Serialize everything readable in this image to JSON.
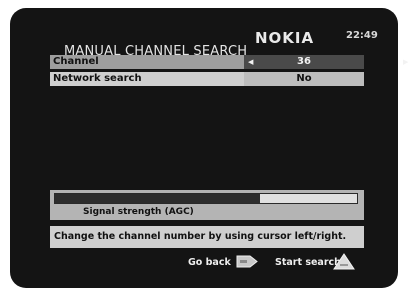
{
  "header": {
    "title": "MANUAL CHANNEL SEARCH",
    "brand": "NOKIA",
    "time": "22:49"
  },
  "menu": {
    "channel": {
      "label": "Channel",
      "value": "36"
    },
    "network_search": {
      "label": "Network search",
      "value": "No"
    }
  },
  "signal": {
    "label": "Signal strength (AGC)",
    "level": 0.68
  },
  "help_text": "Change the channel number by using cursor left/right.",
  "footer": {
    "go_back_label": "Go back",
    "start_search_label": "Start search",
    "go_back_icon": "blue-arrow-key-icon",
    "start_search_icon": "yellow-triangle-key-icon"
  },
  "colors": {
    "background": "#141414",
    "selected_value": "#4a4a4a",
    "panel": "#cfcfcf"
  }
}
